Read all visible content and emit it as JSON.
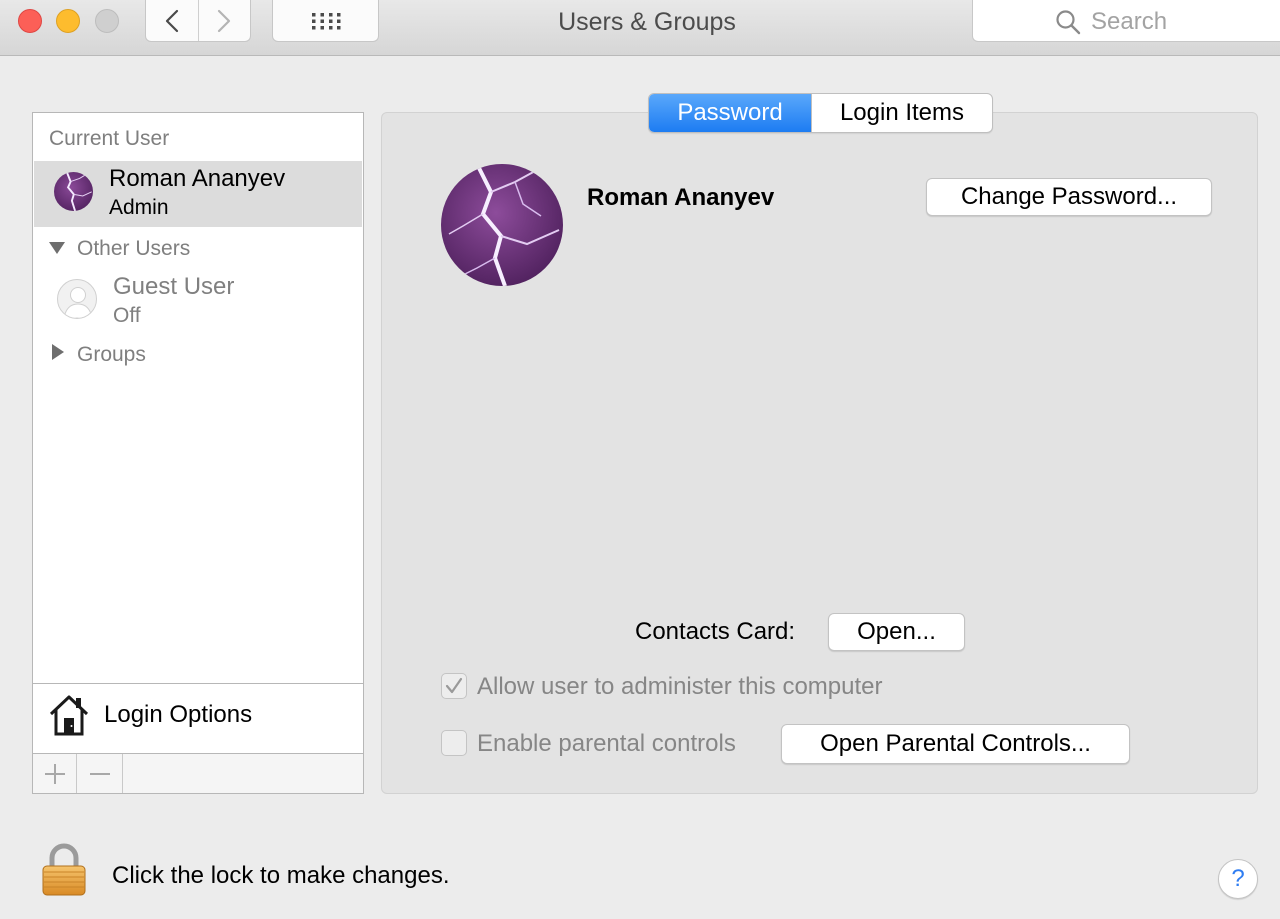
{
  "window": {
    "title": "Users & Groups"
  },
  "search": {
    "placeholder": "Search"
  },
  "sidebar": {
    "current_user_label": "Current User",
    "current_user": {
      "name": "Roman Ananyev",
      "role": "Admin",
      "avatar": "purple-lightning-photo"
    },
    "other_users_label": "Other Users",
    "guest_user": {
      "name": "Guest User",
      "status": "Off"
    },
    "groups_label": "Groups",
    "login_options_label": "Login Options",
    "add_icon": "plus-icon",
    "remove_icon": "minus-icon"
  },
  "tabs": [
    {
      "label": "Password",
      "selected": true
    },
    {
      "label": "Login Items",
      "selected": false
    }
  ],
  "main": {
    "user_name": "Roman Ananyev",
    "change_password_label": "Change Password...",
    "contacts_card_label": "Contacts Card:",
    "open_label": "Open...",
    "allow_admin_label": "Allow user to administer this computer",
    "allow_admin_checked": true,
    "parental_controls_label": "Enable parental controls",
    "parental_controls_checked": false,
    "open_parental_controls_label": "Open Parental Controls..."
  },
  "footer": {
    "lock_text": "Click the lock to make changes.",
    "help_label": "?"
  },
  "colors": {
    "accent": "#1d7cf2",
    "close": "#fc5f57",
    "minimize": "#fdbc2e",
    "avatar_purple": "#6b2b7a"
  }
}
